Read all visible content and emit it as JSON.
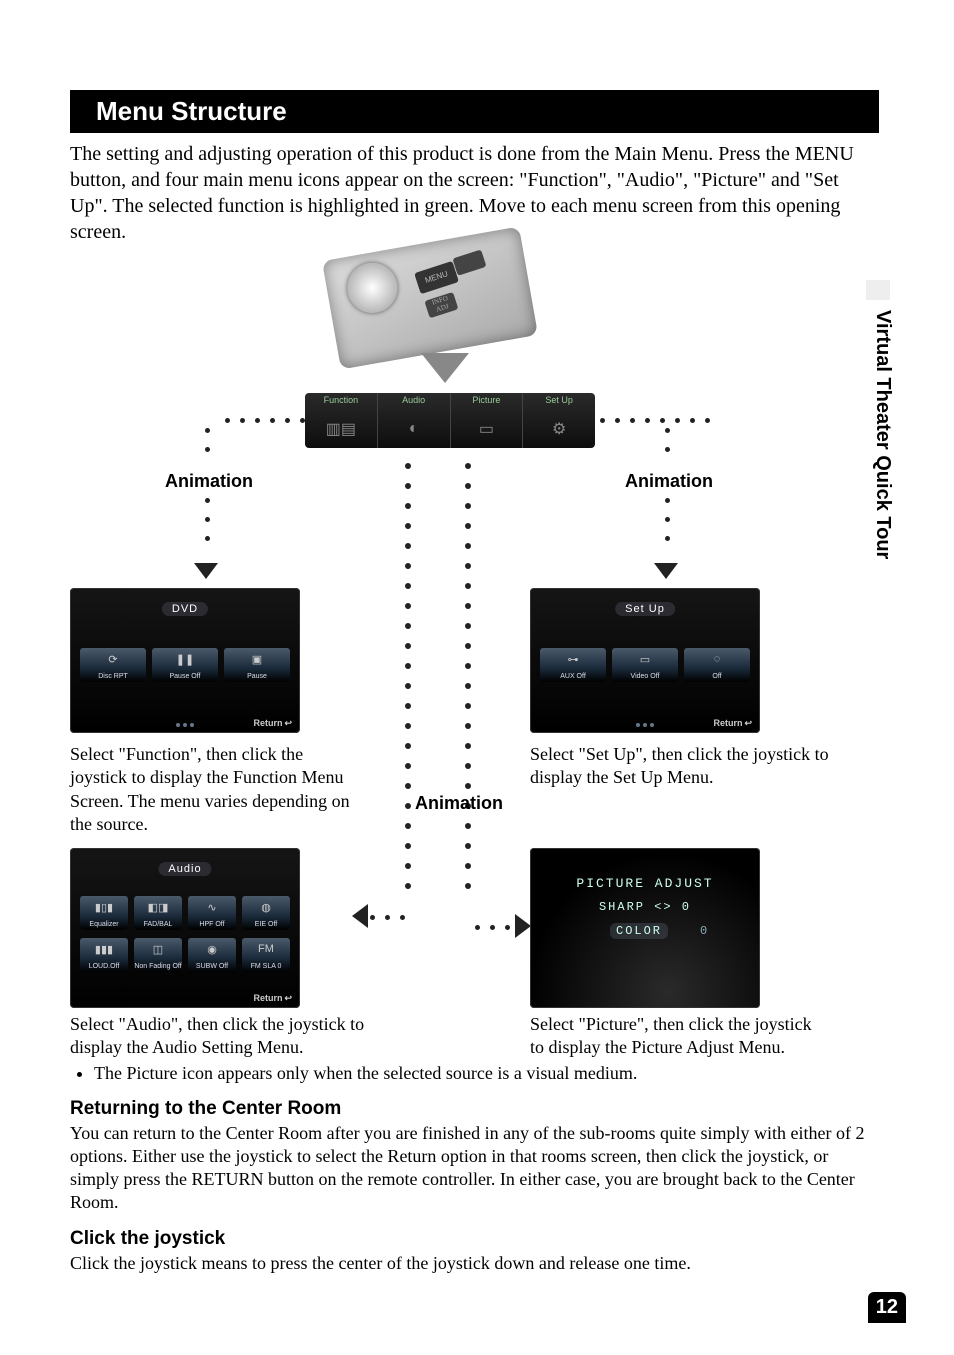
{
  "sectionTitle": "Menu Structure",
  "introText": "The setting and adjusting operation of this product is done from the Main Menu. Press the MENU button, and four main menu icons appear on the screen: \"Function\", \"Audio\", \"Picture\" and \"Set Up\". The selected function is highlighted in green. Move to each menu screen from this opening screen.",
  "sideTab": "Virtual Theater Quick Tour",
  "remote": {
    "buttonMenu": "MENU",
    "buttonInfo": "INFO ADJ"
  },
  "mainMenu": {
    "items": [
      "Function",
      "Audio",
      "Picture",
      "Set Up"
    ]
  },
  "animationLabel": "Animation",
  "screens": {
    "function": {
      "title": "DVD",
      "tiles": [
        "Disc RPT",
        "Pause Off",
        "Pause"
      ],
      "return": "Return",
      "caption": "Select \"Function\", then click the joystick to display the Function Menu Screen. The menu varies depending on the source."
    },
    "audio": {
      "title": "Audio",
      "tilesRow1": [
        "Equalizer",
        "FAD/BAL",
        "HPF Off",
        "EIE Off"
      ],
      "tilesRow2": [
        "LOUD.Off",
        "Non Fading Off",
        "SUBW Off",
        "FM SLA 0"
      ],
      "return": "Return",
      "caption": "Select \"Audio\", then click the joystick to display the Audio Setting Menu."
    },
    "setup": {
      "title": "Set Up",
      "tiles": [
        "AUX Off",
        "Video Off",
        "Off"
      ],
      "return": "Return",
      "caption": "Select \"Set Up\", then click the joystick to display the Set Up Menu."
    },
    "picture": {
      "title": "PICTURE ADJUST",
      "row1": "SHARP <> 0",
      "row2label": "COLOR",
      "row2value": "0",
      "caption": "Select \"Picture\", then click the joystick to display the Picture Adjust Menu."
    }
  },
  "note": "The Picture icon appears only when the selected source is a visual medium.",
  "returning": {
    "heading": "Returning to the Center Room",
    "body": "You can return to the Center Room after you are finished in any of the sub-rooms quite simply with either of 2 options. Either use the joystick to select the Return option in that rooms screen, then click the joystick, or simply press the RETURN button on the remote controller. In either case, you are brought back to the Center Room."
  },
  "clickJoy": {
    "heading": "Click the joystick",
    "body": "Click the joystick means to press the center of the joystick down and release one time."
  },
  "pageNumber": "12"
}
